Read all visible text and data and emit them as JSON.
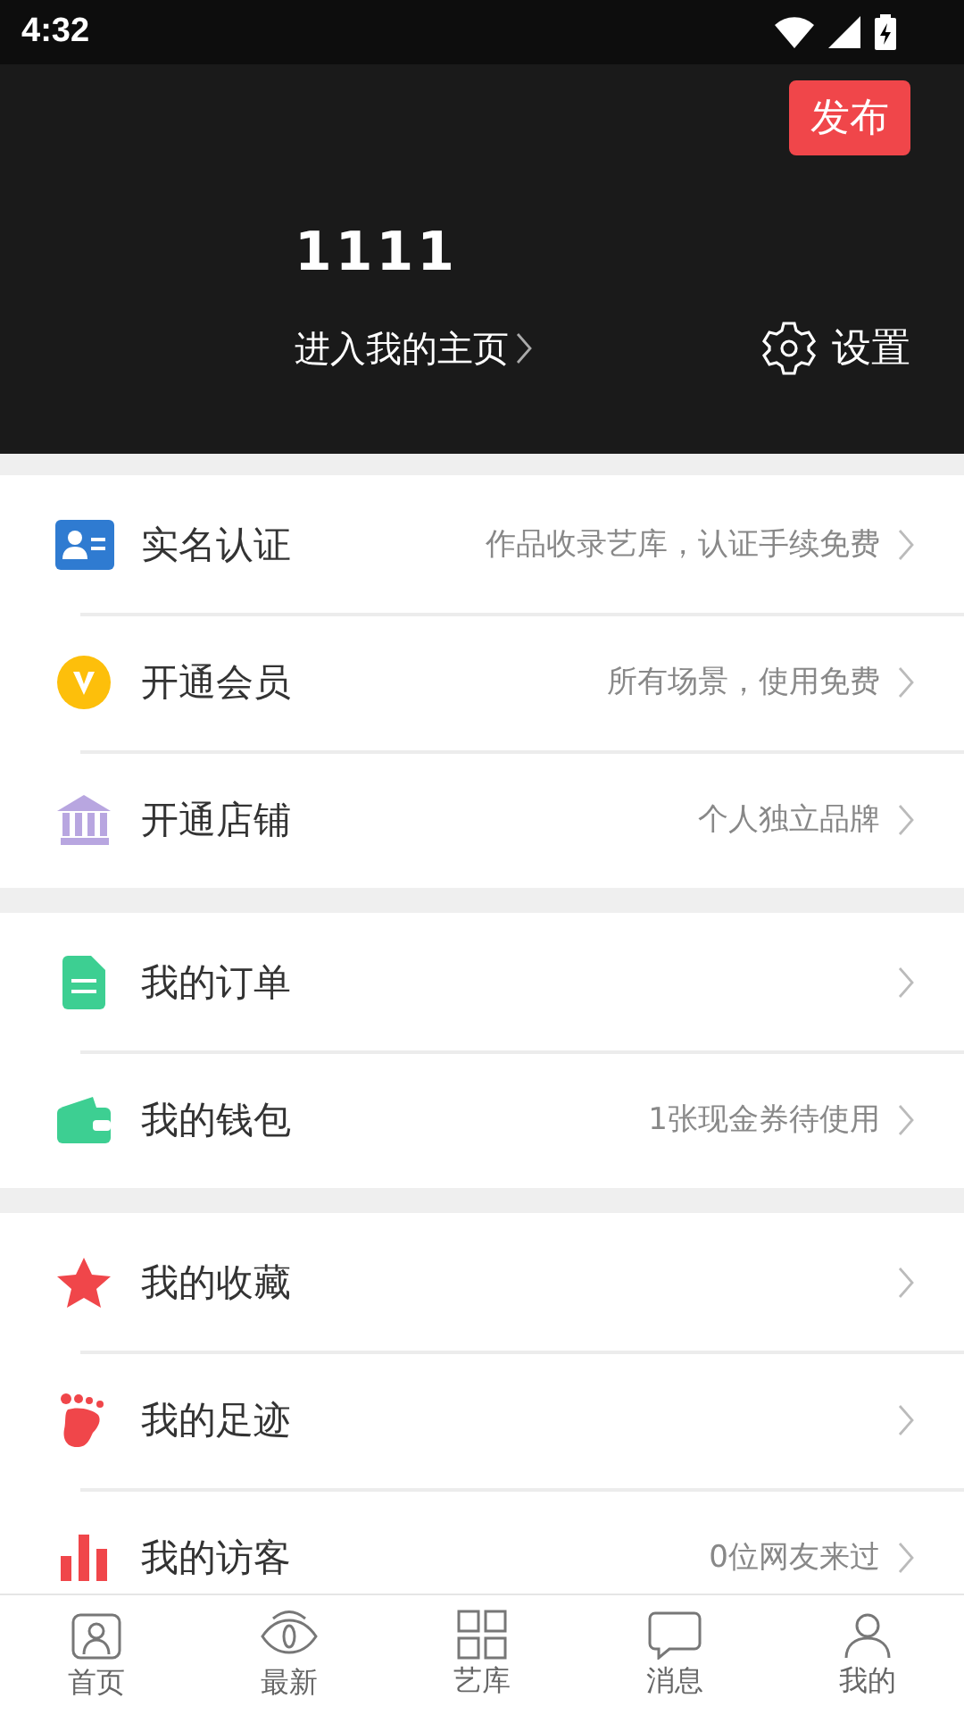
{
  "status_bar": {
    "time": "4:32"
  },
  "header": {
    "publish_button": "发布",
    "username": "1111",
    "homepage_link": "进入我的主页",
    "settings": "设置"
  },
  "groups": [
    {
      "items": [
        {
          "label": "实名认证",
          "hint": "作品收录艺库，认证手续免费"
        },
        {
          "label": "开通会员",
          "hint": "所有场景，使用免费"
        },
        {
          "label": "开通店铺",
          "hint": "个人独立品牌"
        }
      ]
    },
    {
      "items": [
        {
          "label": "我的订单"
        },
        {
          "label": "我的钱包",
          "hint": "1张现金券待使用"
        }
      ]
    },
    {
      "items": [
        {
          "label": "我的收藏"
        },
        {
          "label": "我的足迹"
        },
        {
          "label": "我的访客",
          "hint": "0位网友来过"
        }
      ]
    }
  ],
  "bottom_nav": [
    {
      "label": "首页"
    },
    {
      "label": "最新"
    },
    {
      "label": "艺库"
    },
    {
      "label": "消息"
    },
    {
      "label": "我的"
    }
  ]
}
